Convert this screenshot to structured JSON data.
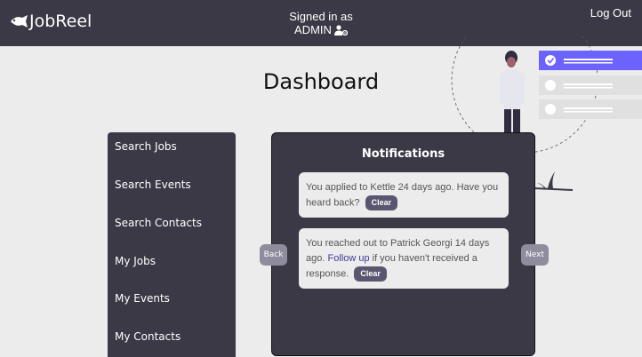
{
  "header": {
    "logo_text": "JobReel",
    "signed_in_label": "Signed in as",
    "username": "ADMIN",
    "logout_label": "Log Out"
  },
  "page": {
    "title": "Dashboard"
  },
  "sidebar": {
    "items": [
      {
        "label": "Search Jobs"
      },
      {
        "label": "Search Events"
      },
      {
        "label": "Search Contacts"
      },
      {
        "label": "My Jobs"
      },
      {
        "label": "My Events"
      },
      {
        "label": "My Contacts"
      }
    ]
  },
  "notifications": {
    "title": "Notifications",
    "back_label": "Back",
    "next_label": "Next",
    "items": [
      {
        "text": "You applied to Kettle 24 days ago. Have you heard back?",
        "clear_label": "Clear"
      },
      {
        "text_before": "You reached out to Patrick Georgi 14 days ago.",
        "link_text": "Follow up",
        "text_after": "if you haven't received a response.",
        "clear_label": "Clear"
      }
    ]
  },
  "colors": {
    "header_bg": "#3b3946",
    "accent": "#6c63ff",
    "button": "#5a5670"
  },
  "icons": {
    "logo": "fish-icon",
    "user": "user-gear-icon"
  }
}
